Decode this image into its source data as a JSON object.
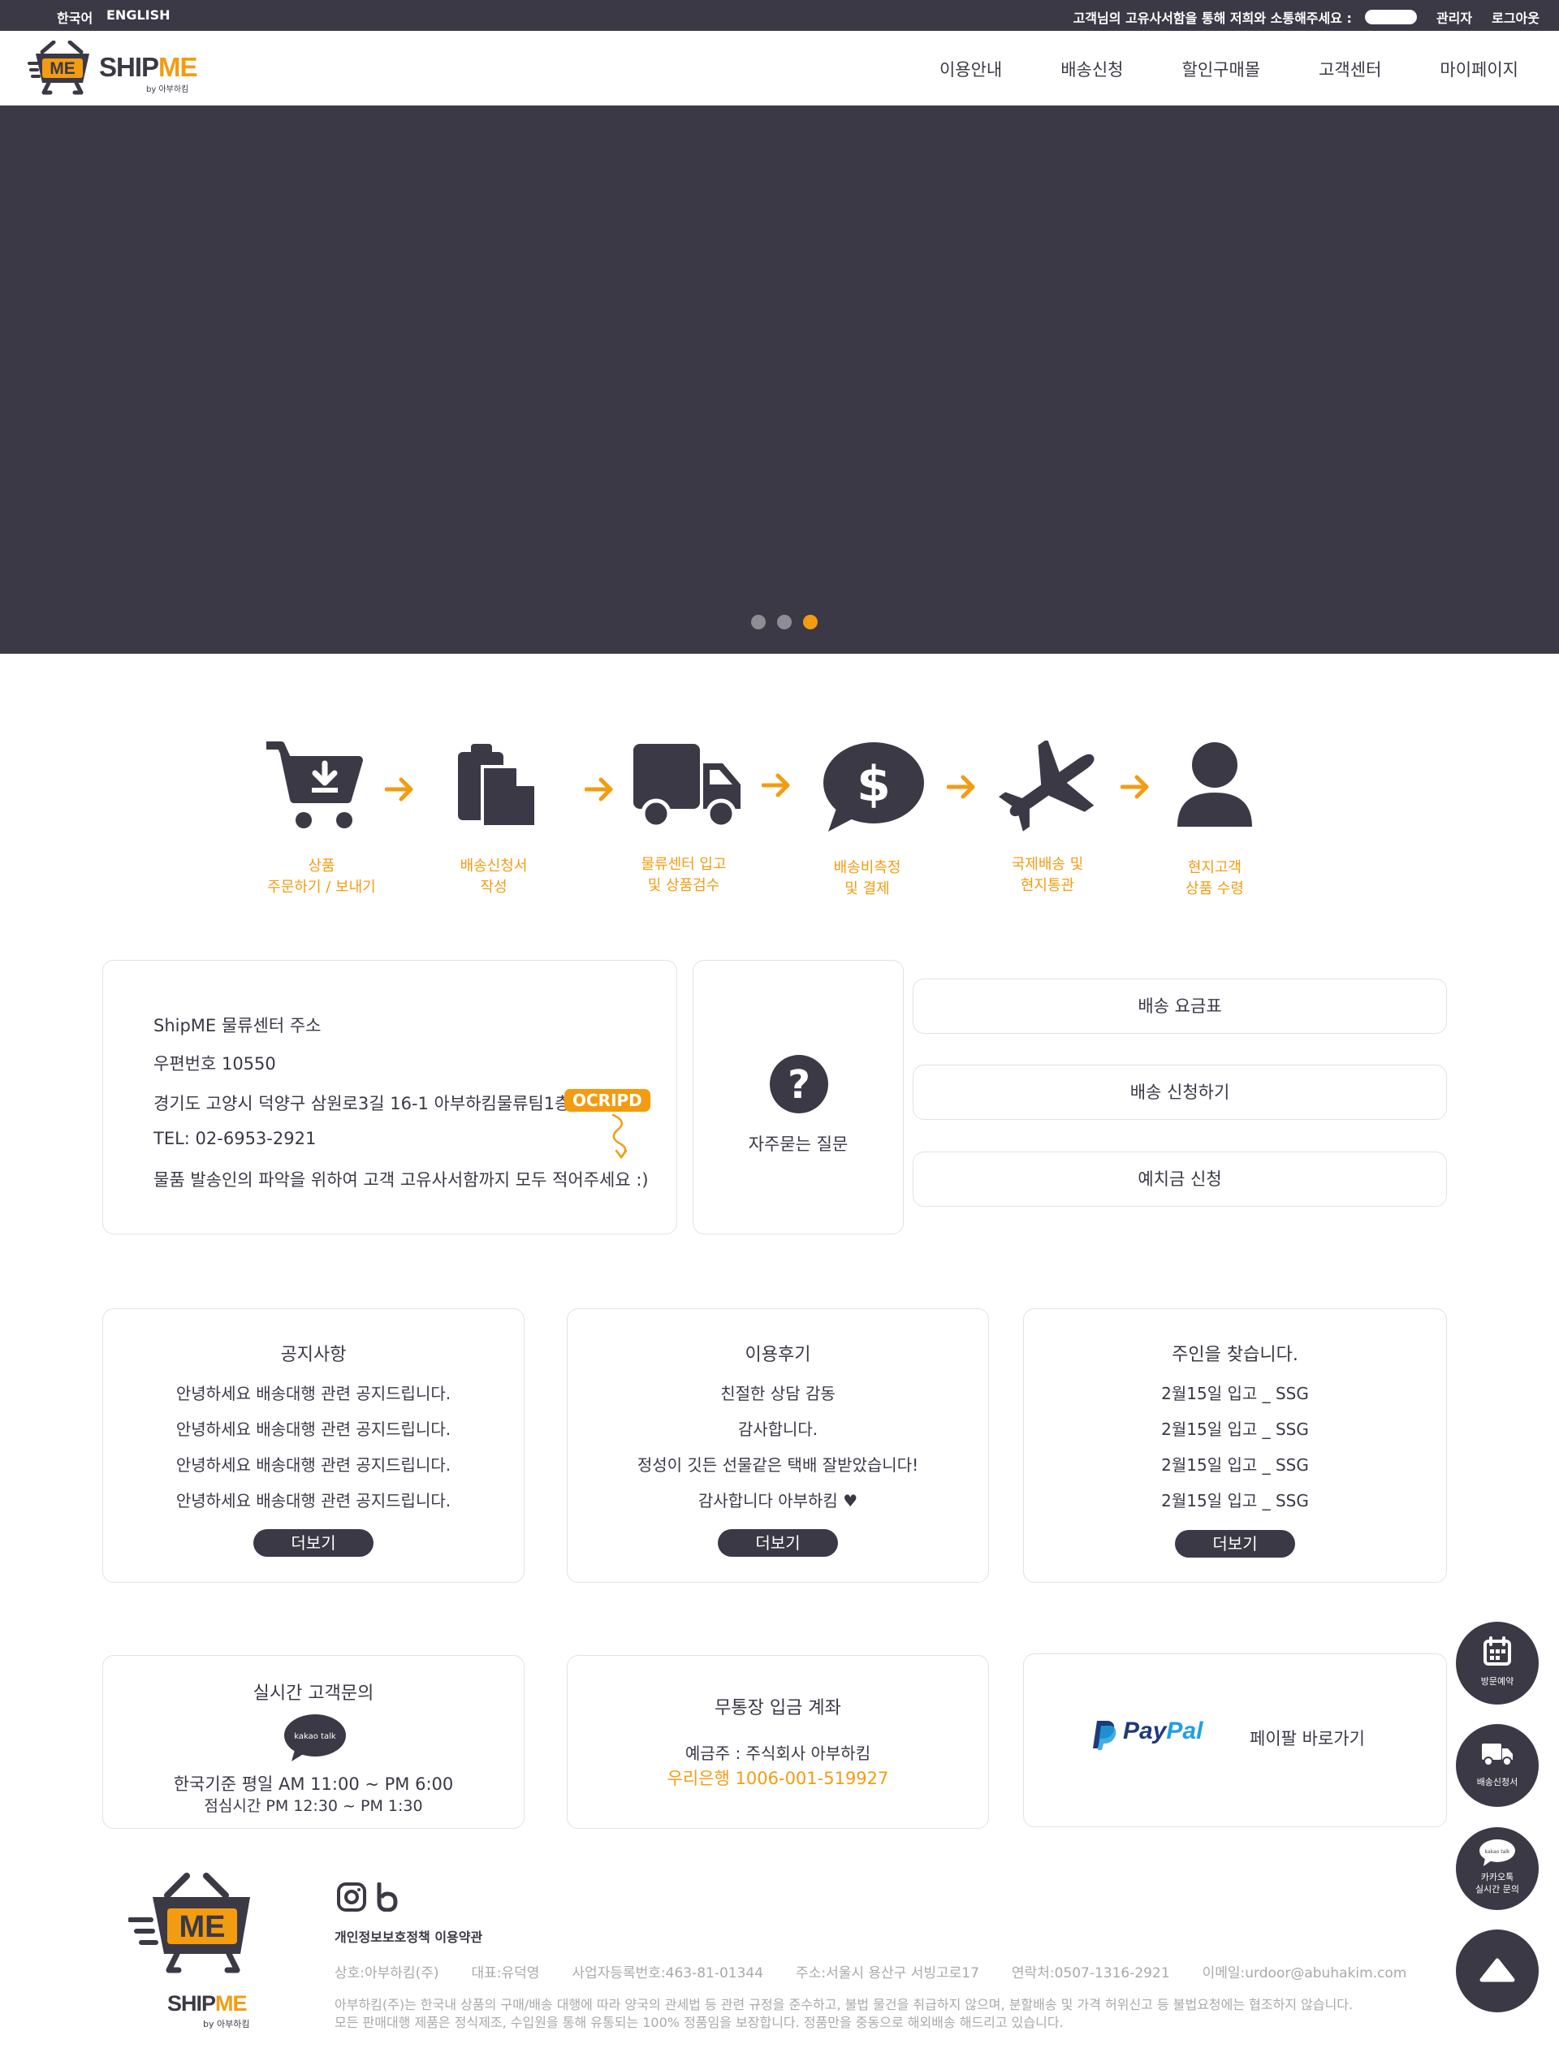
{
  "topbar": {
    "lang_ko": "한국어",
    "lang_en": "ENGLISH",
    "message": "고객님의 고유사서함을 통해 저희와 소통해주세요 :",
    "admin": "관리자",
    "logout": "로그아웃"
  },
  "header": {
    "logo_ship": "SHIP",
    "logo_me": "ME",
    "logo_badge": "ME",
    "logo_sub": "by 아부하킴",
    "nav": [
      "이용안내",
      "배송신청",
      "할인구매몰",
      "고객센터",
      "마이페이지"
    ]
  },
  "hero": {
    "slide_count": 3,
    "active_slide": 3
  },
  "steps": [
    {
      "icon": "cart-download-icon",
      "label": "상품\n주문하기 / 보내기"
    },
    {
      "icon": "document-copy-icon",
      "label": "배송신청서\n작성"
    },
    {
      "icon": "truck-icon",
      "label": "물류센터 입고\n및 상품검수"
    },
    {
      "icon": "dollar-speech-icon",
      "label": "배송비측정\n및 결제"
    },
    {
      "icon": "airplane-icon",
      "label": "국제배송 및\n현지통관"
    },
    {
      "icon": "person-icon",
      "label": "현지고객\n상품 수령"
    }
  ],
  "address": {
    "title": "ShipME 물류센터 주소",
    "zip": "우편번호 10550",
    "addr": "경기도 고양시 덕양구 삼원로3길 16-1 아부하킴물류팀1층",
    "code": "OCRIPD",
    "tel": "TEL: 02-6953-2921",
    "note": "물품 발송인의 파악을 위하여 고객 고유사서함까지 모두 적어주세요 :)"
  },
  "faq": {
    "label": "자주묻는 질문"
  },
  "quick_links": [
    "배송 요금표",
    "배송 신청하기",
    "예치금 신청"
  ],
  "boards": [
    {
      "title": "공지사항",
      "rows": [
        "안녕하세요 배송대행 관련 공지드립니다.",
        "안녕하세요 배송대행 관련 공지드립니다.",
        "안녕하세요 배송대행 관련 공지드립니다.",
        "안녕하세요 배송대행 관련 공지드립니다."
      ],
      "more": "더보기"
    },
    {
      "title": "이용후기",
      "rows": [
        "친절한 상담 감동",
        "감사합니다.",
        "정성이 깃든 선물같은 택배 잘받았습니다!",
        "감사합니다 아부하킴 ♥"
      ],
      "more": "더보기"
    },
    {
      "title": "주인을 찾습니다.",
      "rows": [
        "2월15일 입고 _ SSG",
        "2월15일 입고 _ SSG",
        "2월15일 입고 _ SSG",
        "2월15일 입고 _ SSG"
      ],
      "more": "더보기"
    }
  ],
  "support": {
    "title": "실시간 고객문의",
    "kakao": "kakao talk",
    "hours": "한국기준 평일 AM 11:00 ~ PM 6:00",
    "lunch": "점심시간 PM 12:30 ~ PM 1:30"
  },
  "bank": {
    "title": "무통장 입금 계좌",
    "holder": "예금주 : 주식회사 아부하킴",
    "account": "우리은행 1006-001-519927"
  },
  "paypal": {
    "brand_pay": "Pay",
    "brand_pal": "Pal",
    "label": "페이팔 바로가기"
  },
  "footer": {
    "logo_ship": "SHIP",
    "logo_me": "ME",
    "logo_badge": "ME",
    "logo_sub": "by 아부하킴",
    "links": "개인정보보호정책 이용약관",
    "company": "상호:아부하킴(주)",
    "ceo": "대표:유덕영",
    "bizno": "사업자등록번호:463-81-01344",
    "address": "주소:서울시 용산구 서빙고로17",
    "phone": "연락처:0507-1316-2921",
    "email": "이메일:urdoor@abuhakim.com",
    "note1": "아부하킴(주)는 한국내 상품의 구매/배송 대행에 따라 양국의 관세법 등 관련 규정을 준수하고, 불법 물건을 취급하지 않으며, 분할배송 및 가격 허위신고 등 불법요청에는 협조하지 않습니다.",
    "note2": "모든 판매대행 제품은 정식제조, 수입원을 통해 유통되는 100% 정품임을 보장합니다. 정품만을 중동으로 해외배송 해드리고 있습니다."
  },
  "floating": {
    "visit": "방문예약",
    "ship": "배송신청서",
    "kakao_small": "kakao talk",
    "kakao1": "카카오톡",
    "kakao2": "실시간 문의"
  },
  "colors": {
    "accent": "#f39c12",
    "dark": "#3b3945",
    "border": "#e2e2e2",
    "muted": "#a9a9a9"
  }
}
